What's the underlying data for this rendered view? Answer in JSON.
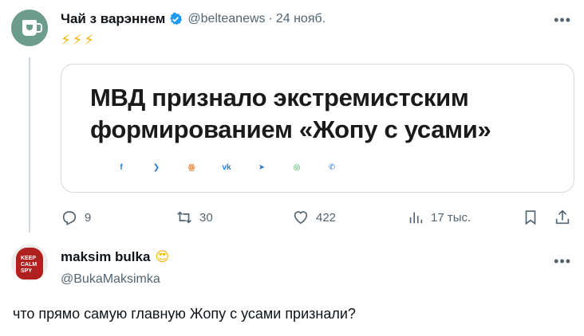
{
  "tweet": {
    "author_name": "Чай з варэннем",
    "author_handle": "@belteanews",
    "date": "24 нояб.",
    "emojis": "⚡⚡⚡",
    "card": {
      "headline_line1": "МВД признало экстремистским",
      "headline_line2": "формированием «Жопу с усами»",
      "share_icons": [
        "facebook-icon",
        "twitter-icon",
        "odnoklassniki-icon",
        "vk-icon",
        "telegram-icon",
        "whatsapp-icon",
        "viber-icon"
      ],
      "share_glyphs": [
        "f",
        "❯",
        "ꙮ",
        "vk",
        "➤",
        "◎",
        "✆"
      ]
    },
    "actions": {
      "replies": "9",
      "retweets": "30",
      "likes": "422",
      "views": "17 тыс."
    }
  },
  "reply": {
    "author_name": "maksim bulka",
    "author_emoji": "😍",
    "author_handle": "@BukaMaksimka",
    "text": "что прямо самую главную Жопу с усами признали?",
    "avatar_text": "KEEP CALM SPY"
  },
  "colors": {
    "accent": "#1d9bf0",
    "muted": "#536471",
    "border": "#cfd9de"
  }
}
